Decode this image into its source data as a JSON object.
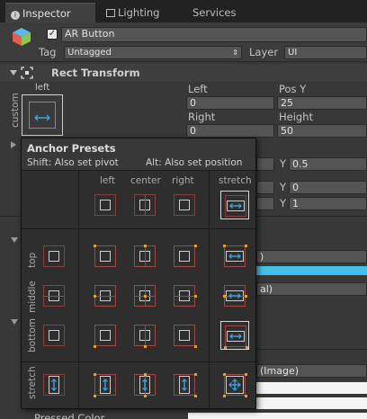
{
  "tabs": [
    {
      "label": "Inspector",
      "icon": "info-icon"
    },
    {
      "label": "Lighting",
      "icon": "lighting-icon"
    },
    {
      "label": "Services"
    }
  ],
  "object": {
    "active": true,
    "name": "AR Button",
    "tag_label": "Tag",
    "tag_value": "Untagged",
    "layer_label": "Layer",
    "layer_value": "UI"
  },
  "rect_transform": {
    "title": "Rect Transform",
    "anchor_h": "left",
    "anchor_v": "custom",
    "left_label": "Left",
    "left_value": "0",
    "posy_label": "Pos Y",
    "posy_value": "25",
    "right_label": "Right",
    "right_value": "0",
    "height_label": "Height",
    "height_value": "50",
    "y1_label": "Y",
    "y1_value": "0.5",
    "y2_label": "Y",
    "y2_value": "0",
    "y3_label": "Y",
    "y3_value": "1"
  },
  "background": {
    "dropdown1": ")",
    "dropdown2": "al)",
    "image_dropdown": "(Image)",
    "bottom_label": "Pressed Color"
  },
  "popup": {
    "title": "Anchor Presets",
    "shift_hint": "Shift: Also set pivot",
    "alt_hint": "Alt: Also set position",
    "columns": [
      "left",
      "center",
      "right",
      "stretch"
    ],
    "rows": [
      "top",
      "middle",
      "bottom",
      "stretch"
    ]
  }
}
